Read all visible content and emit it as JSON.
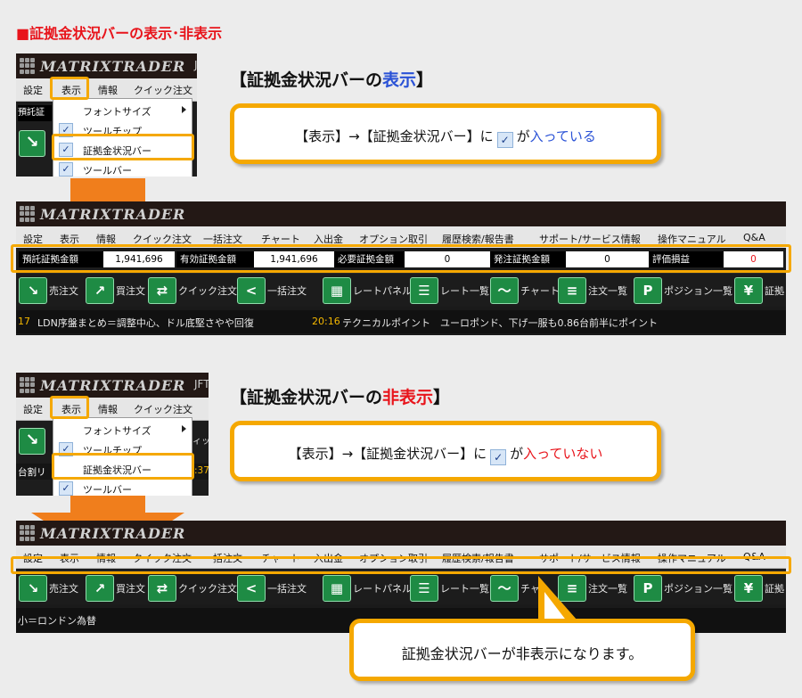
{
  "page_title": "■証拠金状況バーの表示･非表示",
  "app": {
    "logo_text": "MATRIXTRADER",
    "logo_sub_1": "J",
    "logo_sub_2": "JFT"
  },
  "mini_menu": [
    "設定",
    "表示",
    "情報",
    "クイック注文"
  ],
  "dropdown": {
    "font_size": "フォントサイズ",
    "tool_tip": "ツールチップ",
    "margin_bar": "証拠金状況バー",
    "tool_bar": "ツールバー"
  },
  "mini_misc": {
    "top_status_fragment": "預託証",
    "bottom_status_fragment": "台割リ",
    "bottom_toolbar_fragment": "ィック",
    "bottom_time_fragment": ":37"
  },
  "show_section": {
    "heading_prefix": "【証拠金状況バーの",
    "heading_highlight": "表示",
    "heading_suffix": "】",
    "callout_prefix": "【表示】→【証拠金状況バー】に",
    "callout_mid": "が",
    "callout_highlight": "入っている"
  },
  "hide_section": {
    "heading_prefix": "【証拠金状況バーの",
    "heading_highlight": "非表示",
    "heading_suffix": "】",
    "callout_prefix": "【表示】→【証拠金状況バー】に",
    "callout_mid": "が",
    "callout_highlight": "入っていない"
  },
  "main_menu": [
    "設定",
    "表示",
    "情報",
    "クイック注文",
    "一括注文",
    "チャート",
    "入出金",
    "オプション取引",
    "履歴検索/報告書",
    "サポート/サービス情報",
    "操作マニュアル",
    "Q&A"
  ],
  "status_bar": [
    {
      "label": "預託証拠金額",
      "value": "1,941,696"
    },
    {
      "label": "有効証拠金額",
      "value": "1,941,696"
    },
    {
      "label": "必要証拠金額",
      "value": "0"
    },
    {
      "label": "発注証拠金額",
      "value": "0"
    },
    {
      "label": "評価損益",
      "value": "0"
    }
  ],
  "toolbar": [
    {
      "icon": "sell-icon",
      "label": "売注文"
    },
    {
      "icon": "buy-icon",
      "label": "買注文"
    },
    {
      "icon": "quick-order-icon",
      "label": "クイック注文"
    },
    {
      "icon": "bulk-order-icon",
      "label": "一括注文"
    },
    {
      "icon": "rate-panel-icon",
      "label": "レートパネル"
    },
    {
      "icon": "rate-list-icon",
      "label": "レート一覧"
    },
    {
      "icon": "chart-icon",
      "label": "チャート"
    },
    {
      "icon": "order-list-icon",
      "label": "注文一覧"
    },
    {
      "icon": "position-list-icon",
      "label": "ポジション一覧"
    },
    {
      "icon": "margin-icon",
      "label": "証拠"
    }
  ],
  "toolbar_hidden_variant": {
    "chart_label": "チャ"
  },
  "news_show": {
    "time_left": "17",
    "headline_left": "LDN序盤まとめ＝調整中心、ドル底堅さやや回復",
    "time_right": "20:16",
    "headline_right": "テクニカルポイント　ユーロポンド、下げ一服も0.86台前半にポイント"
  },
  "news_hide": {
    "headline_left": "小＝ロンドン為替"
  },
  "result_callout": "証拠金状況バーが非表示になります。",
  "colors": {
    "highlight": "#f5a800",
    "arrow": "#f07e1c",
    "blue": "#2a52d6",
    "red": "#e8141b",
    "button_green": "#1e8b44"
  }
}
